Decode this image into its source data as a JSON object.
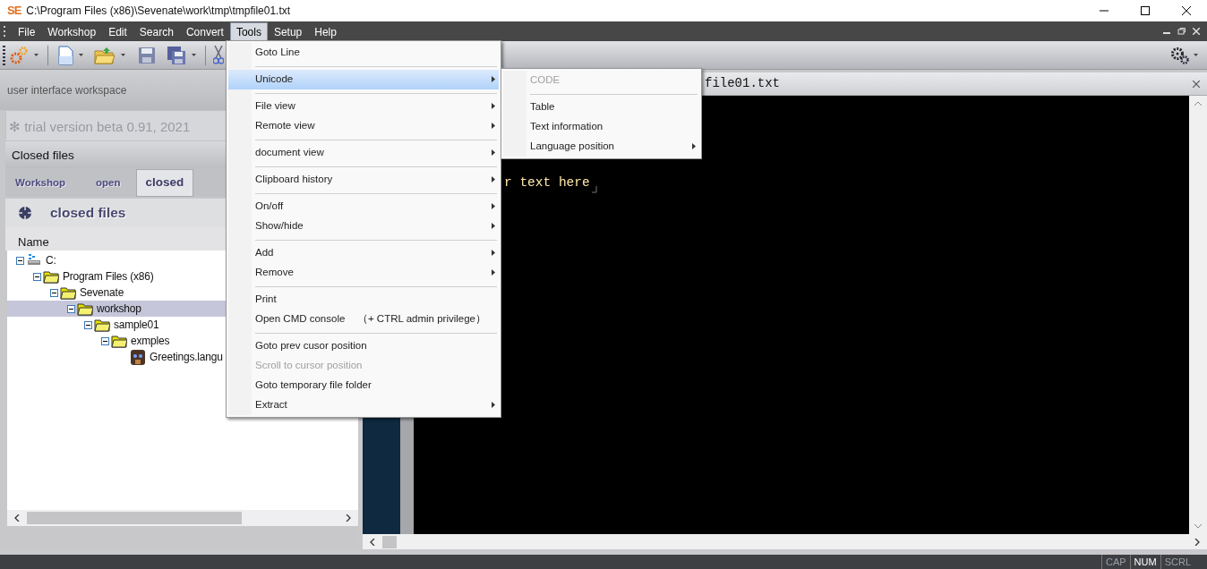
{
  "window": {
    "logo": "SE",
    "title": "C:\\Program Files (x86)\\Sevenate\\work\\tmp\\tmpfile01.txt"
  },
  "menu_bar": [
    {
      "label": "File",
      "selected": false
    },
    {
      "label": "Workshop",
      "selected": false
    },
    {
      "label": "Edit",
      "selected": false
    },
    {
      "label": "Search",
      "selected": false
    },
    {
      "label": "Convert",
      "selected": false
    },
    {
      "label": "Tools",
      "selected": true
    },
    {
      "label": "Setup",
      "selected": false
    },
    {
      "label": "Help",
      "selected": false
    }
  ],
  "tools_menu": [
    {
      "kind": "item",
      "label": "Goto Line",
      "submenu": false,
      "selected": false,
      "disabled": false
    },
    {
      "kind": "separator"
    },
    {
      "kind": "item",
      "label": "Unicode",
      "submenu": true,
      "selected": true,
      "disabled": false
    },
    {
      "kind": "separator"
    },
    {
      "kind": "item",
      "label": "File view",
      "submenu": true,
      "selected": false,
      "disabled": false
    },
    {
      "kind": "item",
      "label": "Remote view",
      "submenu": true,
      "selected": false,
      "disabled": false
    },
    {
      "kind": "separator"
    },
    {
      "kind": "item",
      "label": "document view",
      "submenu": true,
      "selected": false,
      "disabled": false
    },
    {
      "kind": "separator"
    },
    {
      "kind": "item",
      "label": "Clipboard history",
      "submenu": true,
      "selected": false,
      "disabled": false
    },
    {
      "kind": "separator"
    },
    {
      "kind": "item",
      "label": "On/off",
      "submenu": true,
      "selected": false,
      "disabled": false
    },
    {
      "kind": "item",
      "label": "Show/hide",
      "submenu": true,
      "selected": false,
      "disabled": false
    },
    {
      "kind": "separator"
    },
    {
      "kind": "item",
      "label": "Add",
      "submenu": true,
      "selected": false,
      "disabled": false
    },
    {
      "kind": "item",
      "label": "Remove",
      "submenu": true,
      "selected": false,
      "disabled": false
    },
    {
      "kind": "separator"
    },
    {
      "kind": "item",
      "label": "Print",
      "submenu": false,
      "selected": false,
      "disabled": false
    },
    {
      "kind": "item",
      "label": "Open CMD console",
      "shortcut": "（+ CTRL admin privilege）",
      "submenu": false,
      "selected": false,
      "disabled": false
    },
    {
      "kind": "separator"
    },
    {
      "kind": "item",
      "label": "Goto prev cusor position",
      "submenu": false,
      "selected": false,
      "disabled": false
    },
    {
      "kind": "item",
      "label": "Scroll to cursor position",
      "submenu": false,
      "selected": false,
      "disabled": true
    },
    {
      "kind": "item",
      "label": "Goto temporary file folder",
      "submenu": false,
      "selected": false,
      "disabled": false
    },
    {
      "kind": "item",
      "label": "Extract",
      "submenu": true,
      "selected": false,
      "disabled": false
    }
  ],
  "unicode_submenu": [
    {
      "kind": "item",
      "label": "CODE",
      "submenu": false,
      "selected": false,
      "disabled": true
    },
    {
      "kind": "separator"
    },
    {
      "kind": "item",
      "label": "Table",
      "submenu": false,
      "selected": false,
      "disabled": false
    },
    {
      "kind": "item",
      "label": "Text information",
      "submenu": false,
      "selected": false,
      "disabled": false
    },
    {
      "kind": "item",
      "label": "Language position",
      "submenu": true,
      "selected": false,
      "disabled": false
    }
  ],
  "workspace": {
    "caption": "user interface workspace",
    "version": "✻ trial version beta 0.91, 2021"
  },
  "panel": {
    "title": "Closed files",
    "tabs": [
      {
        "label": "Workshop",
        "selected": false
      },
      {
        "label": "open",
        "selected": false
      },
      {
        "label": "closed",
        "selected": true
      }
    ],
    "header": "closed files",
    "column": "Name",
    "tree": [
      {
        "label": "C:",
        "kind": "drive",
        "expanded": true,
        "selected": false,
        "children": [
          {
            "label": "Program Files (x86)",
            "kind": "folder",
            "expanded": true,
            "selected": false,
            "children": [
              {
                "label": "Sevenate",
                "kind": "folder",
                "expanded": true,
                "selected": false,
                "children": [
                  {
                    "label": "workshop",
                    "kind": "folder",
                    "expanded": true,
                    "selected": true,
                    "children": [
                      {
                        "label": "sample01",
                        "kind": "folder",
                        "expanded": true,
                        "selected": false,
                        "children": [
                          {
                            "label": "exmples",
                            "kind": "folder",
                            "expanded": true,
                            "selected": false,
                            "children": [
                              {
                                "label": "Greetings.langu",
                                "kind": "file",
                                "selected": false
                              }
                            ]
                          }
                        ]
                      }
                    ]
                  }
                ]
              }
            ]
          }
        ]
      }
    ]
  },
  "editor": {
    "tab_label": "file01.txt",
    "text": "r text here"
  },
  "status_bar": [
    {
      "label": "CAP",
      "on": false
    },
    {
      "label": "NUM",
      "on": true
    },
    {
      "label": "SCRL",
      "on": false
    }
  ]
}
